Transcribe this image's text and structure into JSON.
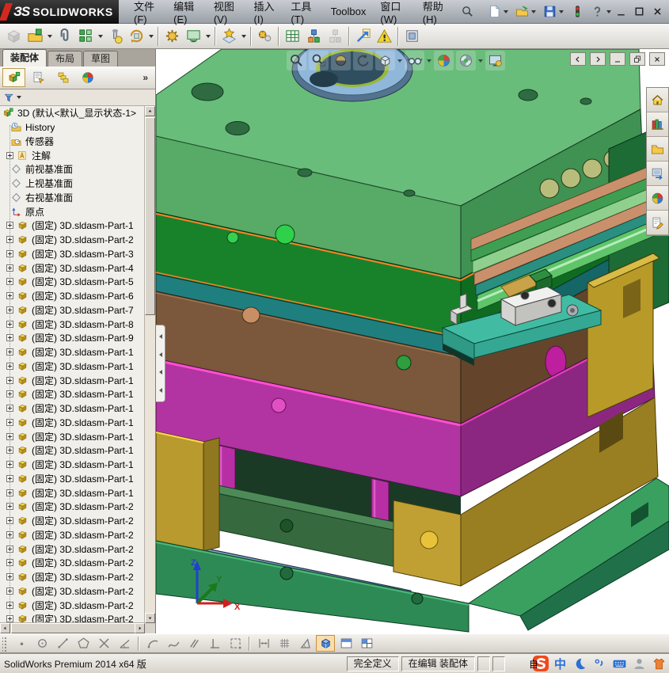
{
  "titlebar": {
    "logo_glyph": "ЗS",
    "brand": "SOLIDWORKS",
    "menus": [
      {
        "name": "menu-file",
        "label": "文件(F)"
      },
      {
        "name": "menu-edit",
        "label": "编辑(E)"
      },
      {
        "name": "menu-view",
        "label": "视图(V)"
      },
      {
        "name": "menu-insert",
        "label": "插入(I)"
      },
      {
        "name": "menu-tools",
        "label": "工具(T)"
      },
      {
        "name": "menu-toolbox",
        "label": "Toolbox"
      },
      {
        "name": "menu-window",
        "label": "窗口(W)"
      },
      {
        "name": "menu-help",
        "label": "帮助(H)"
      }
    ],
    "quick_access": [
      {
        "name": "new-document-icon",
        "dropdown": true
      },
      {
        "name": "open-icon",
        "dropdown": true
      },
      {
        "name": "save-icon",
        "dropdown": true
      },
      {
        "name": "performance-monitor-icon",
        "dropdown": false
      },
      {
        "name": "help-icon",
        "dropdown": true
      }
    ],
    "window_controls": [
      "minimize-icon",
      "maximize-icon",
      "close-icon"
    ]
  },
  "main_toolbar": {
    "buttons": [
      {
        "name": "insert-component-icon",
        "disabled": true
      },
      {
        "name": "insert-from-file-icon",
        "dropdown": true
      },
      {
        "name": "mate-icon"
      },
      {
        "name": "linear-component-pattern-icon",
        "dropdown": true
      },
      {
        "name": "smart-fasteners-icon"
      },
      {
        "name": "move-component-icon",
        "dropdown": true,
        "sep_after": true
      },
      {
        "name": "assembly-features-icon"
      },
      {
        "name": "component-preview-icon",
        "dropdown": true,
        "sep_after": true
      },
      {
        "name": "reference-geometry-icon",
        "dropdown": true,
        "sep_after": true
      },
      {
        "name": "motion-study-icon",
        "sep_after": true
      },
      {
        "name": "bill-of-materials-icon"
      },
      {
        "name": "exploded-view-icon"
      },
      {
        "name": "explode-line-sketch-icon",
        "disabled": true,
        "sep_after": true
      },
      {
        "name": "measure-icon"
      },
      {
        "name": "assembly-visualization-icon",
        "sep_after": true
      },
      {
        "name": "screenshot-icon"
      }
    ]
  },
  "feature_panel": {
    "tabs": [
      {
        "name": "tab-assembly",
        "label": "装配体",
        "active": true
      },
      {
        "name": "tab-layout",
        "label": "布局",
        "active": false
      },
      {
        "name": "tab-sketch",
        "label": "草图",
        "active": false
      }
    ],
    "manager_tabs": [
      "feature-manager-design-tree",
      "property-manager",
      "configuration-manager",
      "display-manager"
    ],
    "overflow_label": "»",
    "filter_icon": "filter-funnel-icon"
  },
  "feature_tree": {
    "root_label": "3D  (默认<默认_显示状态-1>",
    "items": [
      {
        "icon": "history-icon",
        "label": "History",
        "expandable": false
      },
      {
        "icon": "sensors-icon",
        "label": "传感器",
        "expandable": false
      },
      {
        "icon": "annotations-icon",
        "label": "注解",
        "expandable": true
      },
      {
        "icon": "plane-icon",
        "label": "前视基准面",
        "expandable": false
      },
      {
        "icon": "plane-icon",
        "label": "上视基准面",
        "expandable": false
      },
      {
        "icon": "plane-icon",
        "label": "右视基准面",
        "expandable": false
      },
      {
        "icon": "origin-icon",
        "label": "原点",
        "expandable": false
      }
    ],
    "parts": [
      "(固定) 3D.sldasm-Part-1",
      "(固定) 3D.sldasm-Part-2",
      "(固定) 3D.sldasm-Part-3",
      "(固定) 3D.sldasm-Part-4",
      "(固定) 3D.sldasm-Part-5",
      "(固定) 3D.sldasm-Part-6",
      "(固定) 3D.sldasm-Part-7",
      "(固定) 3D.sldasm-Part-8",
      "(固定) 3D.sldasm-Part-9",
      "(固定) 3D.sldasm-Part-1",
      "(固定) 3D.sldasm-Part-1",
      "(固定) 3D.sldasm-Part-1",
      "(固定) 3D.sldasm-Part-1",
      "(固定) 3D.sldasm-Part-1",
      "(固定) 3D.sldasm-Part-1",
      "(固定) 3D.sldasm-Part-1",
      "(固定) 3D.sldasm-Part-1",
      "(固定) 3D.sldasm-Part-1",
      "(固定) 3D.sldasm-Part-1",
      "(固定) 3D.sldasm-Part-1",
      "(固定) 3D.sldasm-Part-2",
      "(固定) 3D.sldasm-Part-2",
      "(固定) 3D.sldasm-Part-2",
      "(固定) 3D.sldasm-Part-2",
      "(固定) 3D.sldasm-Part-2",
      "(固定) 3D.sldasm-Part-2",
      "(固定) 3D.sldasm-Part-2",
      "(固定) 3D.sldasm-Part-2",
      "(固定) 3D.sldasm-Part-2"
    ]
  },
  "viewport": {
    "heads_up": [
      {
        "name": "zoom-to-fit-icon"
      },
      {
        "name": "zoom-to-area-icon"
      },
      {
        "name": "section-view-icon"
      },
      {
        "name": "previous-view-icon"
      },
      {
        "name": "view-orientation-icon",
        "dropdown": true
      },
      {
        "name": "hide-show-items-icon",
        "dropdown": true
      },
      {
        "name": "edit-appearance-icon"
      },
      {
        "name": "apply-scene-icon",
        "dropdown": true
      },
      {
        "name": "view-settings-icon"
      }
    ],
    "doc_controls": [
      "previous-window-icon",
      "next-window-icon",
      "minimize-document-icon",
      "restore-document-icon",
      "close-document-icon"
    ],
    "triad": {
      "x": "X",
      "y": "Y",
      "z": "Z"
    },
    "model_colors": {
      "top_clamp_plate": "#69BD7A",
      "cavity_plate": "#17822A",
      "edge_highlight_orange": "#FF7F27",
      "support_plate_teal": "#1F7F7F",
      "core_plate_brown": "#7B573B",
      "stripper_plate_magenta": "#B233A2",
      "spacer_block_yellow": "#BD9E30",
      "ejector_retainer_green": "#37693F",
      "ejector_plate_blue": "#55779D",
      "base_plate_green": "#2E8A55",
      "locating_ring_blue": "#8FB7D9",
      "guide_pin_magenta": "#B82FA5",
      "slide_plate_teal": "#41BCA3",
      "limit_switch_white": "#F2F2F0",
      "rail_salmon": "#C9906B",
      "rail_green": "#3F9E52"
    }
  },
  "task_pane": {
    "tabs": [
      "solidworks-resources-icon",
      "design-library-icon",
      "file-explorer-icon",
      "view-palette-icon",
      "appearances-scenes-icon",
      "custom-properties-icon"
    ]
  },
  "sketch_toolbar": {
    "buttons": [
      {
        "name": "point-icon",
        "disabled": true
      },
      {
        "name": "circle-icon",
        "disabled": true
      },
      {
        "name": "line-icon",
        "disabled": true
      },
      {
        "name": "polygon-icon",
        "disabled": true
      },
      {
        "name": "trim-icon",
        "disabled": true
      },
      {
        "name": "angle-icon",
        "disabled": true
      },
      {
        "sep": true
      },
      {
        "name": "tangent-arc-icon",
        "disabled": true
      },
      {
        "name": "spline-icon",
        "disabled": true
      },
      {
        "name": "parallel-icon",
        "disabled": true
      },
      {
        "name": "perpendicular-icon",
        "disabled": true
      },
      {
        "name": "selection-box-icon",
        "disabled": true
      },
      {
        "sep": true
      },
      {
        "name": "dimension-icon",
        "disabled": true
      },
      {
        "name": "grid-icon",
        "disabled": true
      },
      {
        "name": "angle-snap-icon",
        "disabled": true
      },
      {
        "name": "view-cube-icon",
        "active": true
      },
      {
        "name": "viewport-split-icon"
      },
      {
        "name": "viewport-grid-icon"
      }
    ]
  },
  "status_bar": {
    "product": "SolidWorks Premium 2014 x64 版",
    "cells": [
      "完全定义",
      "在编辑 装配体",
      "",
      ""
    ],
    "ime": {
      "hidden_text": "自",
      "lang_label": "中",
      "icons": [
        "sogou-s-icon",
        "moon-icon",
        "punctuation-icon",
        "keyboard-icon",
        "account-icon",
        "skin-icon"
      ]
    }
  }
}
